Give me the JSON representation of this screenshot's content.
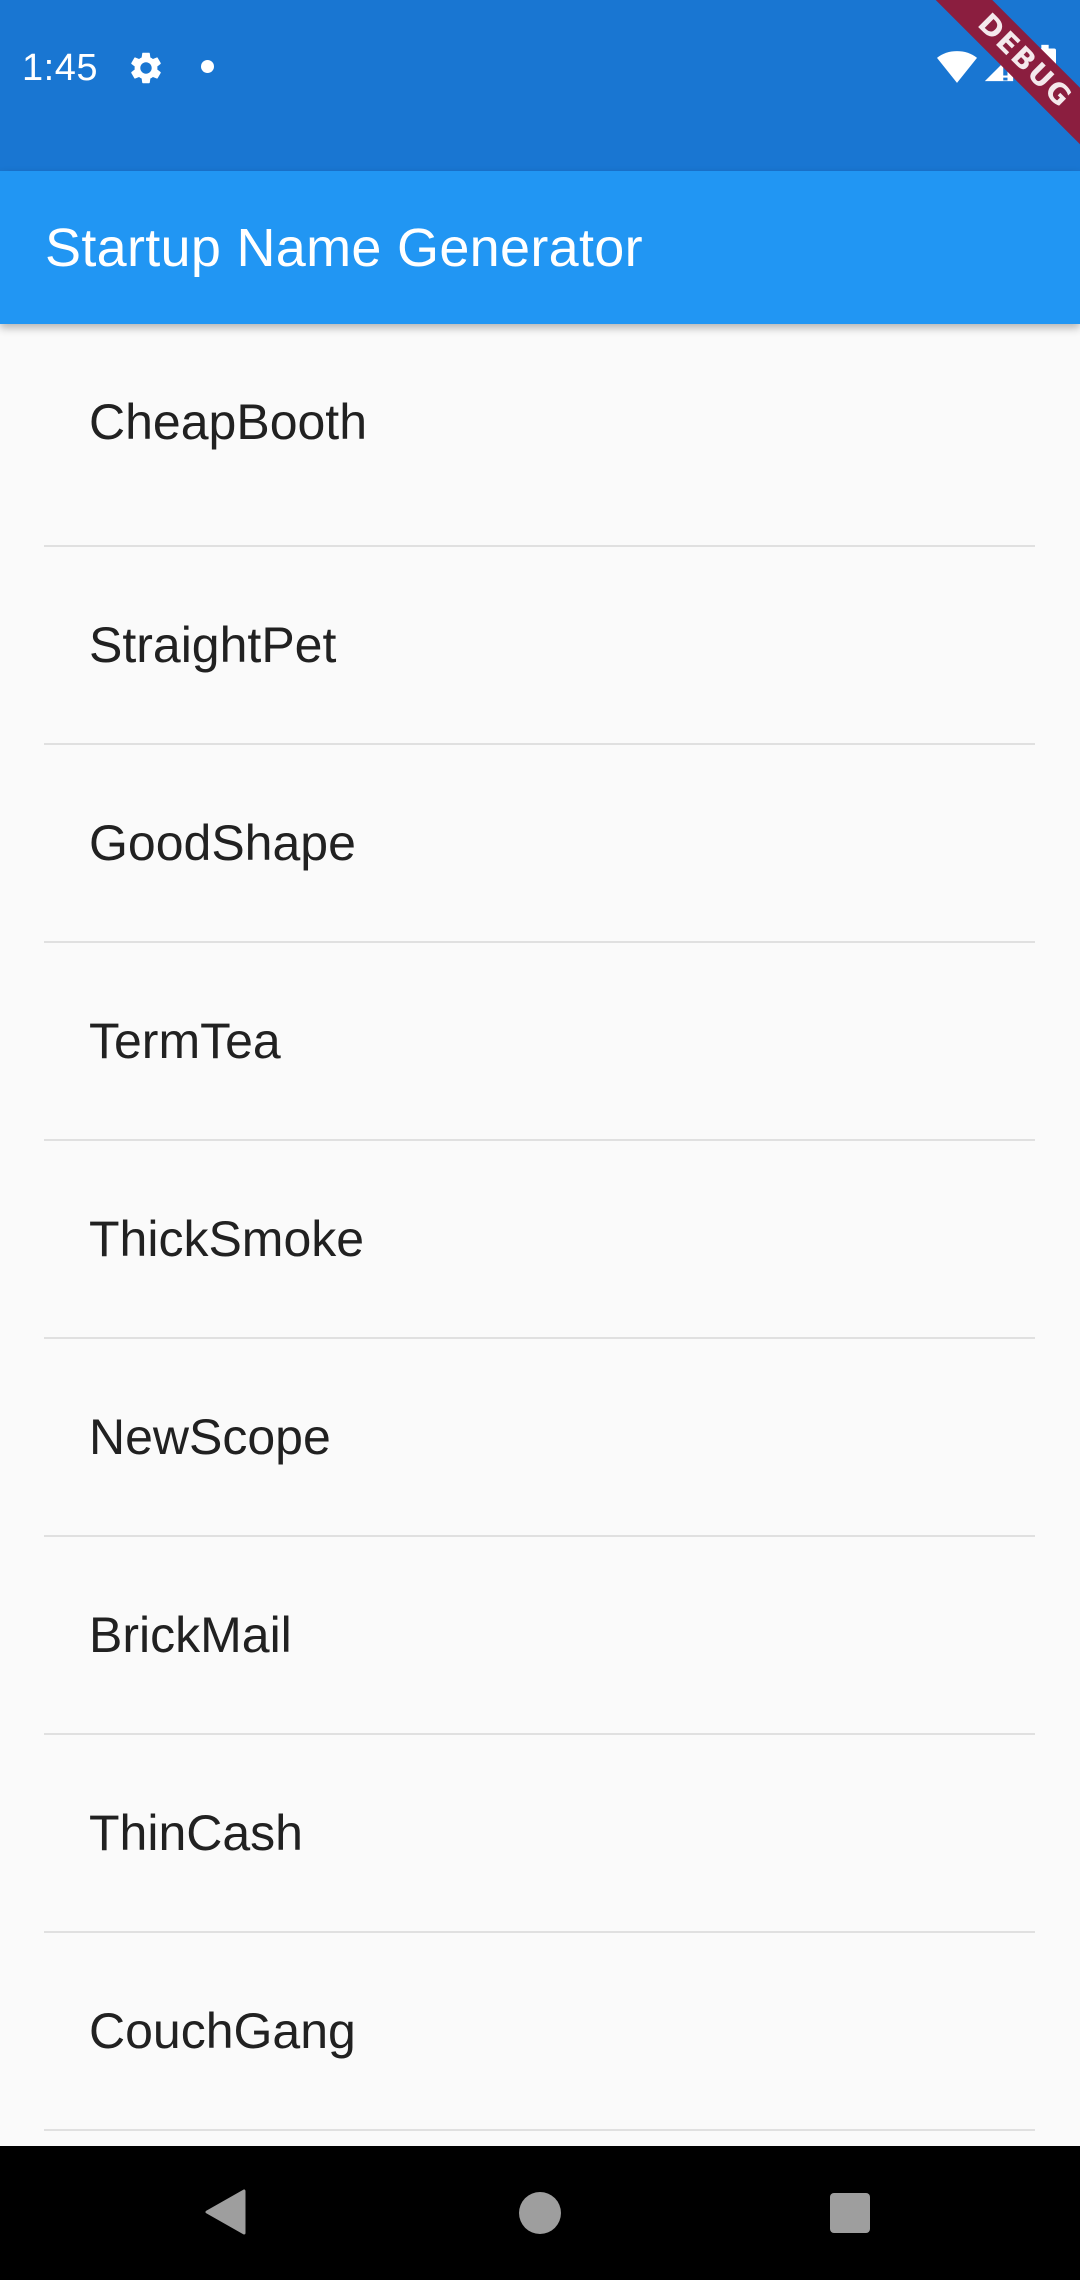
{
  "status_bar": {
    "time": "1:45",
    "icons": [
      "gear-icon",
      "notification-dot-icon",
      "wifi-icon",
      "signal-icon",
      "battery-icon"
    ],
    "background": "#1976d2"
  },
  "debug_banner": {
    "label": "DEBUG",
    "color": "#8b1e3f"
  },
  "app_bar": {
    "title": "Startup Name Generator",
    "background": "#2196f3"
  },
  "list": {
    "items": [
      {
        "label": "CheapBooth"
      },
      {
        "label": "StraightPet"
      },
      {
        "label": "GoodShape"
      },
      {
        "label": "TermTea"
      },
      {
        "label": "ThickSmoke"
      },
      {
        "label": "NewScope"
      },
      {
        "label": "BrickMail"
      },
      {
        "label": "ThinCash"
      },
      {
        "label": "CouchGang"
      }
    ]
  },
  "nav_bar": {
    "buttons": [
      "back-icon",
      "home-icon",
      "recents-icon"
    ]
  }
}
